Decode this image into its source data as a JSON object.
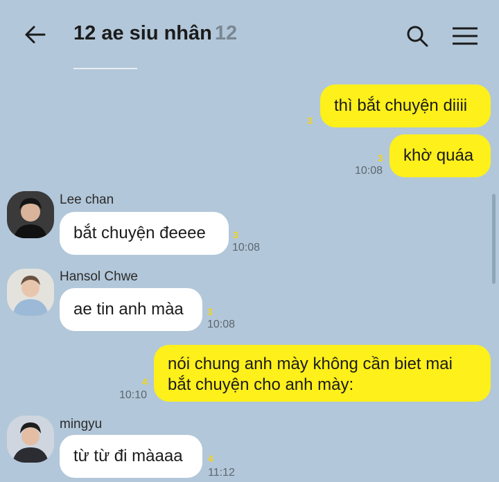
{
  "header": {
    "title": "12 ae siu nhân",
    "member_count": "12",
    "back_icon": "arrow-left-icon",
    "search_icon": "search-icon",
    "menu_icon": "hamburger-menu-icon"
  },
  "messages": [
    {
      "from": "me",
      "text": "thì bắt chuyện diiii",
      "unread": "3",
      "time": ""
    },
    {
      "from": "me",
      "text": "khờ quáa",
      "unread": "3",
      "time": "10:08"
    },
    {
      "from": "Lee chan",
      "text": "bắt chuyện đeeee",
      "unread": "3",
      "time": "10:08"
    },
    {
      "from": "Hansol Chwe",
      "text": "ae tin anh màa",
      "unread": "3",
      "time": "10:08"
    },
    {
      "from": "me",
      "line1": "nói chung anh mày không cần biet mai",
      "line2": "bắt chuyện cho anh mày:",
      "unread": "4",
      "time": "10:10"
    },
    {
      "from": "mingyu",
      "text": "từ từ đi màaaa",
      "unread": "4",
      "time": "11:12"
    }
  ],
  "colors": {
    "background": "#b2c7d9",
    "my_bubble": "#fef01b",
    "other_bubble": "#ffffff",
    "unread": "#f2d31d"
  }
}
